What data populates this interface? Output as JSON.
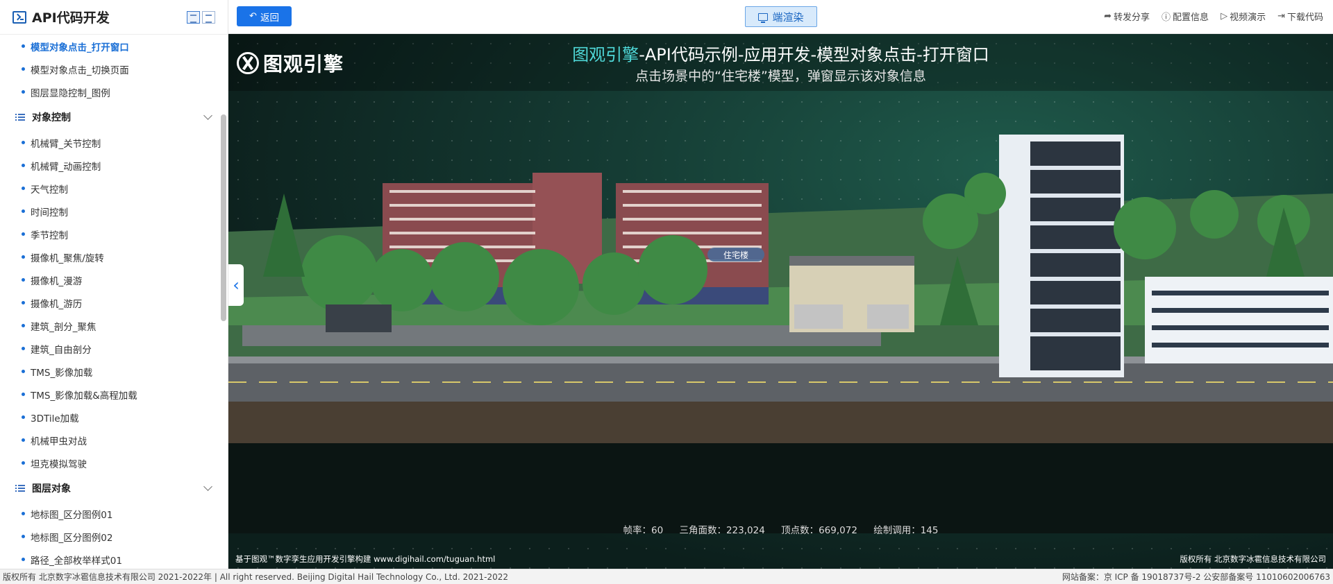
{
  "sidebar": {
    "title": "API代码开发",
    "items_top": [
      {
        "label": "模型对象点击_打开窗口",
        "active": true
      },
      {
        "label": "模型对象点击_切换页面"
      },
      {
        "label": "图层显隐控制_图例"
      }
    ],
    "group1": "对象控制",
    "items_group1": [
      "机械臂_关节控制",
      "机械臂_动画控制",
      "天气控制",
      "时间控制",
      "季节控制",
      "摄像机_聚焦/旋转",
      "摄像机_漫游",
      "摄像机_游历",
      "建筑_剖分_聚焦",
      "建筑_自由剖分",
      "TMS_影像加载",
      "TMS_影像加载&高程加载",
      "3DTile加载",
      "机械甲虫对战",
      "坦克模拟驾驶"
    ],
    "group2": "图层对象",
    "items_group2": [
      "地标图_区分图例01",
      "地标图_区分图例02",
      "路径_全部枚举样式01"
    ]
  },
  "topbar": {
    "back_label": "返回",
    "render_label": "端渲染",
    "actions": [
      "转发分享",
      "配置信息",
      "视频演示",
      "下载代码"
    ]
  },
  "viewer": {
    "brand": "图观引擎",
    "title_highlight": "图观引擎",
    "title_rest": "-API代码示例-应用开发-模型对象点击-打开窗口",
    "subtitle": "点击场景中的“住宅楼”模型，弹窗显示该对象信息",
    "building_label": "住宅楼",
    "stats": {
      "fps": "帧率：60",
      "triangles": "三角面数：223,024",
      "vertices": "顶点数：669,072",
      "drawcalls": "绘制调用：145"
    },
    "credit_left": "基于图观™数字孪生应用开发引擎构建 www.digihail.com/tuguan.html",
    "credit_right": "版权所有 北京数字冰雹信息技术有限公司"
  },
  "footer": {
    "left": "版权所有 北京数字冰雹信息技术有限公司 2021-2022年 | All right reserved. Beijing Digital Hail Technology Co., Ltd. 2021-2022",
    "right": "网站备案：京 ICP 备 19018737号-2 公安部备案号 11010602006763"
  },
  "colors": {
    "accent": "#1a73e8",
    "title_highlight": "#4fd8d8",
    "scene_bg": "#153c34"
  }
}
